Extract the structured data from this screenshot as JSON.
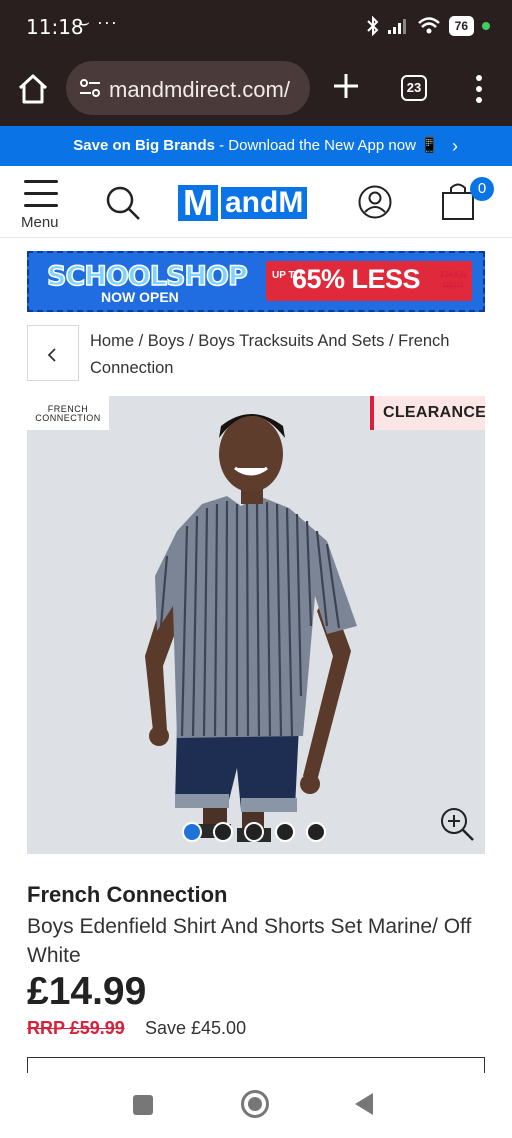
{
  "status_bar": {
    "time": "11:18",
    "notifications": "⌣ ···",
    "battery": "76"
  },
  "browser": {
    "url": "mandmdirect.com/",
    "tab_count": "23"
  },
  "promo": {
    "bold_text": "Save on Big Brands",
    "rest_text": " - Download the New App now 📱"
  },
  "header": {
    "menu_label": "Menu",
    "logo_m": "M",
    "logo_andm": "andM",
    "cart_count": "0"
  },
  "banner": {
    "school_shop": "SCHOOLSHOP",
    "now_open": "NOW OPEN",
    "up_to": "UP TO",
    "percent_less": "65% LESS",
    "than_rrp": "THAN RRP"
  },
  "breadcrumb": {
    "text": "Home / Boys / Boys Tracksuits And Sets / French Connection"
  },
  "product": {
    "brand_logo_text": "FRENCH CONNECTION",
    "badge": "CLEARANCE",
    "image_count": 5,
    "active_image": 1,
    "brand": "French Connection",
    "title": "Boys Edenfield Shirt And Shorts Set Marine/ Off White",
    "price": "£14.99",
    "rrp": "RRP £59.99",
    "save": "Save £45.00"
  },
  "colors": {
    "brand_blue": "#0a74e6",
    "clearance_red": "#d8203a",
    "status_bar_bg": "#2a1f1f"
  }
}
